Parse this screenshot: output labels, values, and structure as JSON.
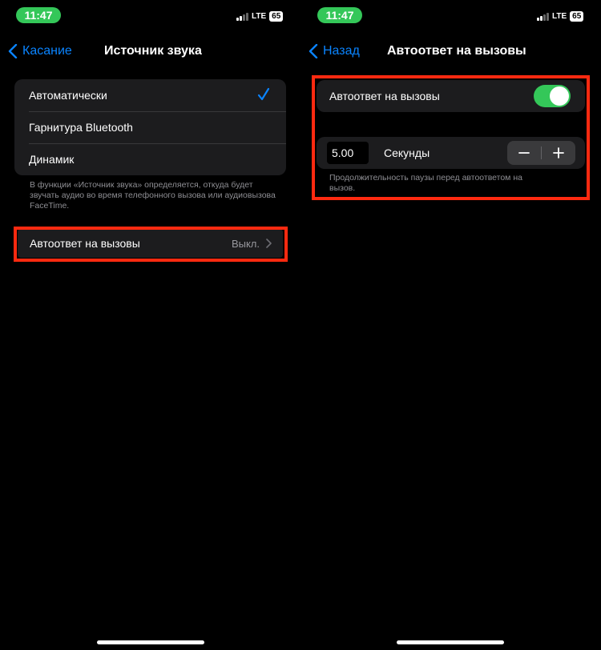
{
  "left": {
    "status": {
      "time": "11:47",
      "network": "LTE",
      "battery": "65"
    },
    "nav": {
      "back_label": "Касание",
      "title": "Источник звука"
    },
    "options": [
      {
        "label": "Автоматически",
        "selected": true
      },
      {
        "label": "Гарнитура Bluetooth",
        "selected": false
      },
      {
        "label": "Динамик",
        "selected": false
      }
    ],
    "footer": "В функции «Источник звука» определяется, откуда будет звучать аудио во время телефонного вызова или аудиовызова FaceTime.",
    "auto_answer": {
      "label": "Автоответ на вызовы",
      "value": "Выкл."
    }
  },
  "right": {
    "status": {
      "time": "11:47",
      "network": "LTE",
      "battery": "65"
    },
    "nav": {
      "back_label": "Назад",
      "title": "Автоответ на вызовы"
    },
    "toggle": {
      "label": "Автоответ на вызовы",
      "on": true
    },
    "duration": {
      "value": "5.00",
      "unit_label": "Секунды"
    },
    "footer": "Продолжительность паузы перед автоответом на вызов."
  },
  "colors": {
    "accent": "#0a84ff",
    "toggle_on": "#34c759",
    "highlight": "#ff2a10",
    "cell_bg": "#1c1c1e"
  },
  "icons": [
    "chevron-left-icon",
    "checkmark-icon",
    "chevron-right-icon",
    "minus-icon",
    "plus-icon",
    "signal-icon",
    "battery-icon"
  ]
}
